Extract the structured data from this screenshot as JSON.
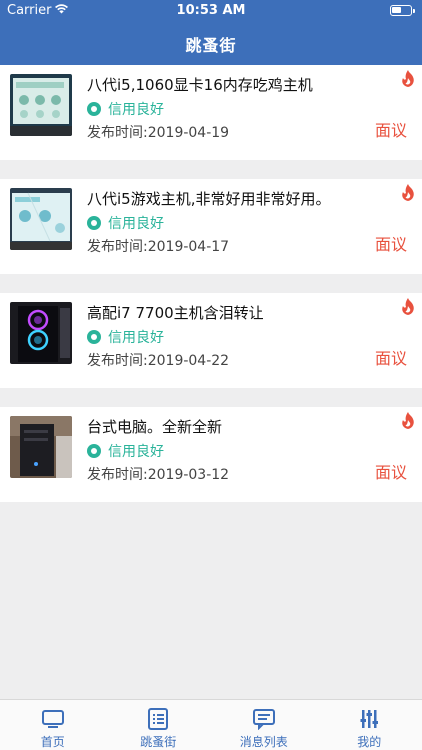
{
  "status_bar": {
    "carrier": "Carrier",
    "time": "10:53 AM"
  },
  "nav": {
    "title": "跳蚤街"
  },
  "items": [
    {
      "title": "八代i5,1060显卡16内存吃鸡主机",
      "credit": "信用良好",
      "date": "发布时间:2019-04-19",
      "price": "面议",
      "thumb_icon": "monitor-screen-photo"
    },
    {
      "title": "八代i5游戏主机,非常好用非常好用。",
      "credit": "信用良好",
      "date": "发布时间:2019-04-17",
      "price": "面议",
      "thumb_icon": "monitor-screen-photo"
    },
    {
      "title": "高配i7 7700主机含泪转让",
      "credit": "信用良好",
      "date": "发布时间:2019-04-22",
      "price": "面议",
      "thumb_icon": "pc-case-rgb-fans-photo"
    },
    {
      "title": "台式电脑。全新全新",
      "credit": "信用良好",
      "date": "发布时间:2019-03-12",
      "price": "面议",
      "thumb_icon": "desktop-tower-photo"
    }
  ],
  "tabbar": {
    "tabs": [
      {
        "label": "首页",
        "icon": "monitor-icon"
      },
      {
        "label": "跳蚤街",
        "icon": "list-icon"
      },
      {
        "label": "消息列表",
        "icon": "chat-icon"
      },
      {
        "label": "我的",
        "icon": "settings-sliders-icon"
      }
    ]
  },
  "colors": {
    "brand": "#3d6fba",
    "credit": "#2ab39a",
    "price": "#e8513e",
    "hot": "#e8513e"
  }
}
